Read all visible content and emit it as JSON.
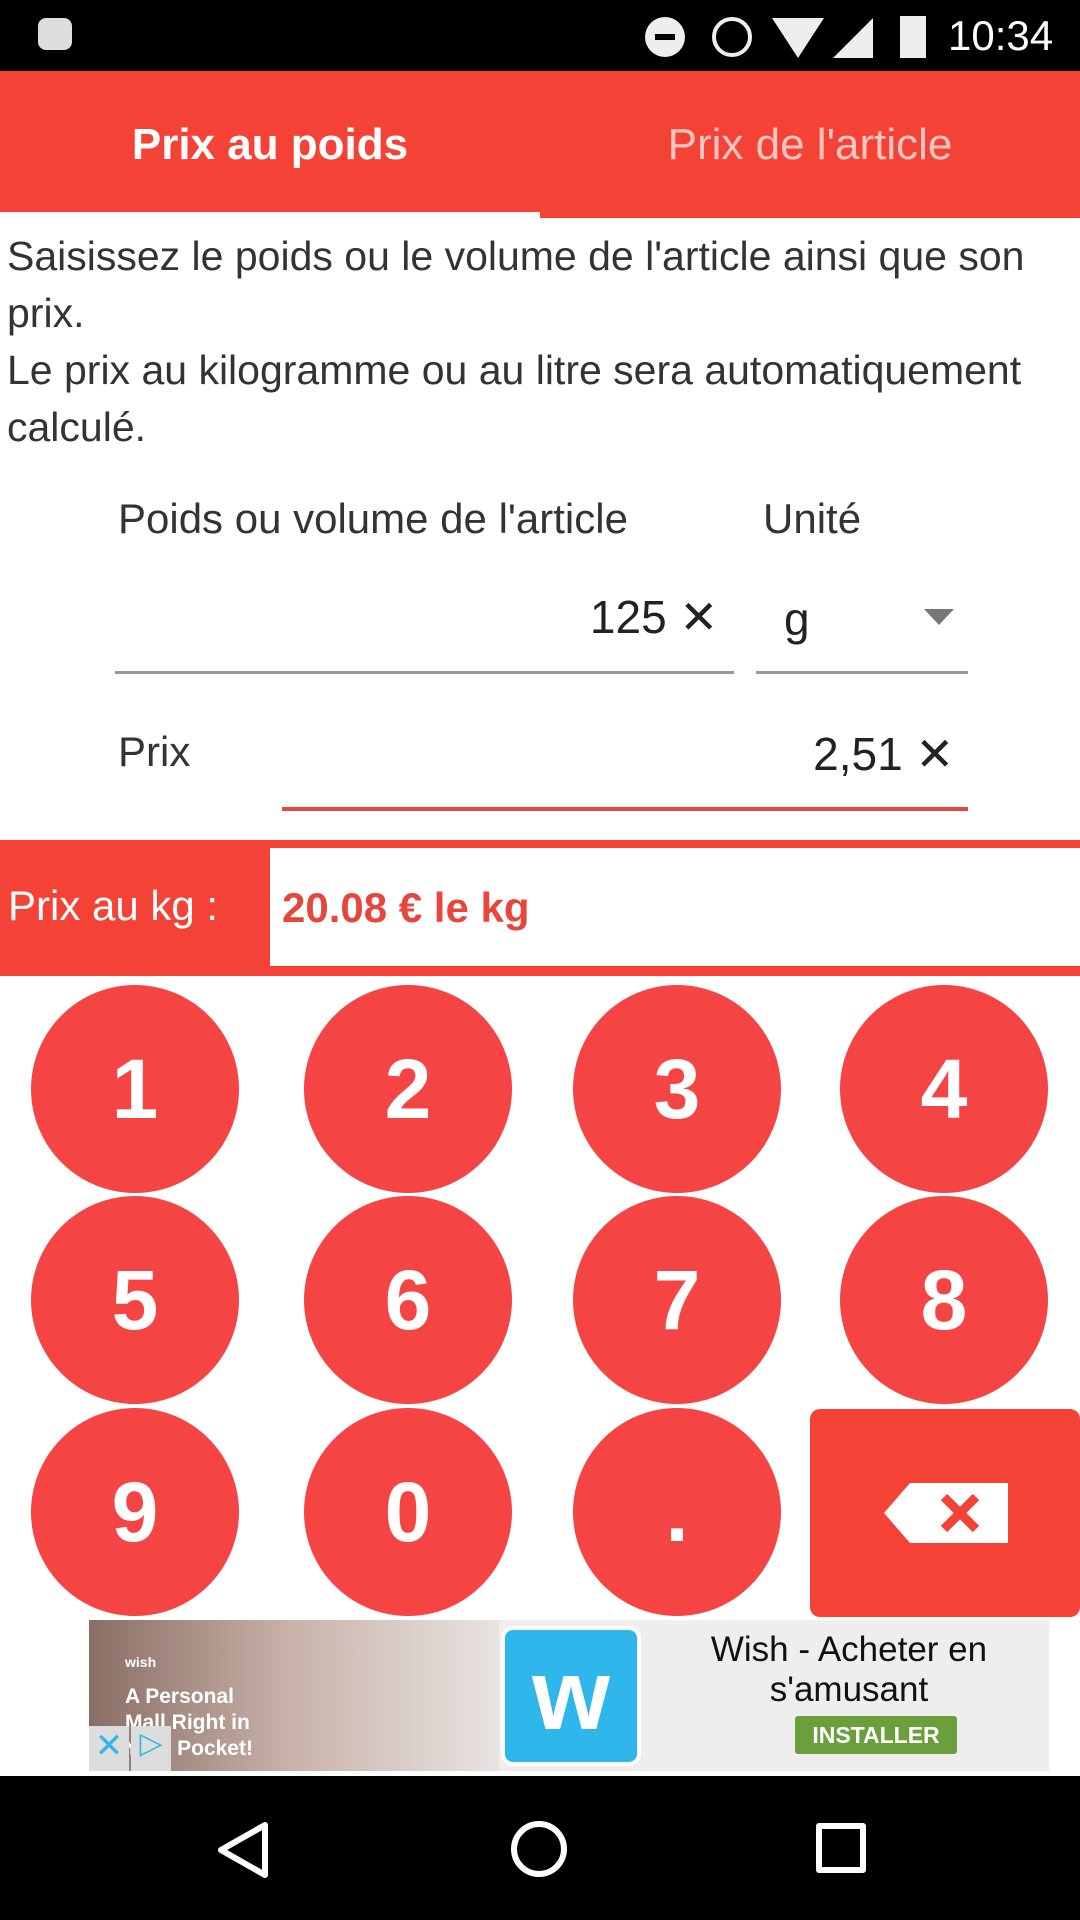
{
  "status_bar": {
    "time": "10:34",
    "icons": [
      "android-icon",
      "dnd-icon",
      "alarm-icon",
      "wifi-icon",
      "signal-icon",
      "battery-charging-icon"
    ]
  },
  "tabs": [
    {
      "label": "Prix au poids",
      "active": true
    },
    {
      "label": "Prix de l'article",
      "active": false
    }
  ],
  "description": "Saisissez le poids ou le volume de l'article ainsi que son prix.\nLe prix au kilogramme ou au litre sera automatiquement calculé.",
  "form": {
    "weight_label": "Poids ou volume de l'article",
    "weight_value": "125",
    "unit_label": "Unité",
    "unit_value": "g",
    "price_label": "Prix",
    "price_value": "2,51",
    "clear_glyph": "✕"
  },
  "result": {
    "label": "Prix au kg :",
    "value": "20.08 € le kg"
  },
  "keypad": [
    "1",
    "2",
    "3",
    "4",
    "5",
    "6",
    "7",
    "8",
    "9",
    "0",
    "."
  ],
  "ad": {
    "title": "Wish - Acheter en s'amusant",
    "button": "INSTALLER",
    "image_text": "A Personal Mall Right in Your Pocket!",
    "brand": "wish"
  },
  "colors": {
    "primary": "#f44336",
    "key": "#f44444",
    "install": "#6a9f3b",
    "wish_blue": "#2fb7ec"
  }
}
